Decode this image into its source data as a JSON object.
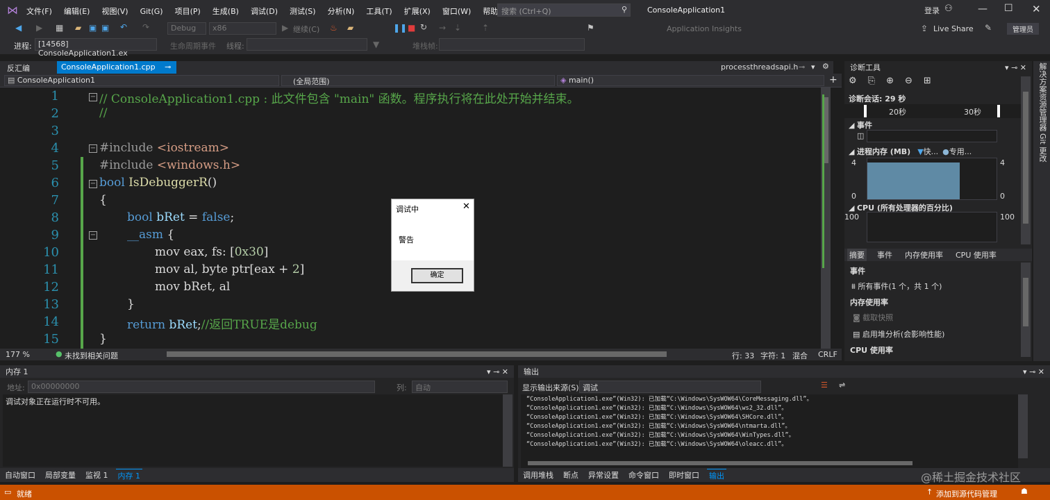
{
  "menu": {
    "items": [
      "文件(F)",
      "编辑(E)",
      "视图(V)",
      "Git(G)",
      "项目(P)",
      "生成(B)",
      "调试(D)",
      "测试(S)",
      "分析(N)",
      "工具(T)",
      "扩展(X)",
      "窗口(W)",
      "帮助(H)"
    ],
    "search_placeholder": "搜索 (Ctrl+Q)",
    "window_title": "ConsoleApplication1",
    "login": "登录",
    "live_share": "Live Share",
    "admin": "管理员"
  },
  "toolbar": {
    "config": "Debug",
    "platform": "x86",
    "continue": "继续(C)",
    "app_insights": "Application Insights"
  },
  "toolbar2": {
    "process_label": "进程:",
    "process_value": "[14568] ConsoleApplication1.ex",
    "lifecycle": "生命周期事件",
    "thread_label": "线程:",
    "stack_label": "堆栈帧:"
  },
  "tabs": {
    "disasm": "反汇编",
    "active": "ConsoleApplication1.cpp",
    "right": "processthreadsapi.h"
  },
  "navbar": {
    "project": "ConsoleApplication1",
    "scope": "(全局范围)",
    "func": "main()"
  },
  "editor": {
    "lines": [
      "1",
      "2",
      "3",
      "4",
      "5",
      "6",
      "7",
      "8",
      "9",
      "10",
      "11",
      "12",
      "13",
      "14",
      "15"
    ],
    "code": {
      "l1": "// ConsoleApplication1.cpp : 此文件包含 \"main\" 函数。程序执行将在此处开始并结束。",
      "l2": "//",
      "l4a": "#include ",
      "l4b": "<iostream>",
      "l5a": "#include ",
      "l5b": "<windows.h>",
      "l6a": "bool ",
      "l6b": "IsDebuggerR",
      "l6c": "()",
      "l7": "{",
      "l8a": "bool ",
      "l8b": "bRet",
      "l8c": " = ",
      "l8d": "false",
      ";": ";",
      "l9a": "__asm ",
      "l9b": "{",
      "l10a": "mov eax, fs: [",
      "l10b": "0x30",
      "l10c": "]",
      "l11a": "mov al, byte ptr[eax + ",
      "l11b": "2",
      "l11c": "]",
      "l12": "mov bRet, al",
      "l13": "}",
      "l14a": "return ",
      "l14b": "bRet",
      "l14c": "//返回TRUE是debug",
      "l15": "}"
    }
  },
  "editor_status": {
    "zoom": "177 %",
    "issues": "未找到相关问题",
    "line": "行: 33",
    "col": "字符: 1",
    "mixed": "混合",
    "crlf": "CRLF"
  },
  "dialog": {
    "title": "调试中",
    "message": "警告",
    "ok": "确定"
  },
  "diag": {
    "title": "诊断工具",
    "session": "诊断会话: 29 秒",
    "t20": "20秒",
    "t30": "30秒",
    "events": "事件",
    "memory": "进程内存 (MB)",
    "fast": "快...",
    "private": "专用...",
    "mem_max": "4",
    "mem_min": "0",
    "cpu": "CPU (所有处理器的百分比)",
    "cpu_max": "100",
    "tabs": [
      "摘要",
      "事件",
      "内存使用率",
      "CPU 使用率"
    ],
    "sec_events": "事件",
    "all_events": "所有事件(1 个，共 1 个)",
    "sec_mem": "内存使用率",
    "snapshot": "截取快照",
    "heap": "启用堆分析(会影响性能)",
    "sec_cpu": "CPU 使用率"
  },
  "sidetabs": {
    "a": "解决方案资源管理器",
    "b": "Git 更改"
  },
  "memory_panel": {
    "title": "内存 1",
    "addr_label": "地址:",
    "addr_value": "0x00000000",
    "col_label": "列:",
    "col_value": "自动",
    "message": "调试对象正在运行时不可用。"
  },
  "output_panel": {
    "title": "输出",
    "source_label": "显示输出来源(S):",
    "source_value": "调试",
    "lines": [
      "“ConsoleApplication1.exe”(Win32): 已加载“C:\\Windows\\SysWOW64\\CoreMessaging.dll”。",
      "“ConsoleApplication1.exe”(Win32): 已加载“C:\\Windows\\SysWOW64\\ws2_32.dll”。",
      "“ConsoleApplication1.exe”(Win32): 已加载“C:\\Windows\\SysWOW64\\SHCore.dll”。",
      "“ConsoleApplication1.exe”(Win32): 已加载“C:\\Windows\\SysWOW64\\ntmarta.dll”。",
      "“ConsoleApplication1.exe”(Win32): 已加载“C:\\Windows\\SysWOW64\\WinTypes.dll”。",
      "“ConsoleApplication1.exe”(Win32): 已加载“C:\\Windows\\SysWOW64\\oleacc.dll”。"
    ]
  },
  "bottom_tabs_left": [
    "自动窗口",
    "局部变量",
    "监视 1",
    "内存 1"
  ],
  "bottom_tabs_right": [
    "调用堆栈",
    "断点",
    "异常设置",
    "命令窗口",
    "即时窗口",
    "输出"
  ],
  "status": {
    "ready": "就绪",
    "source_control": "添加到源代码管理"
  },
  "watermark": "@稀土掘金技术社区",
  "colors": {
    "status": "#ca5100",
    "accent": "#007acc",
    "memory_bar": "#5f8aa5"
  },
  "mem_level": 0.9
}
